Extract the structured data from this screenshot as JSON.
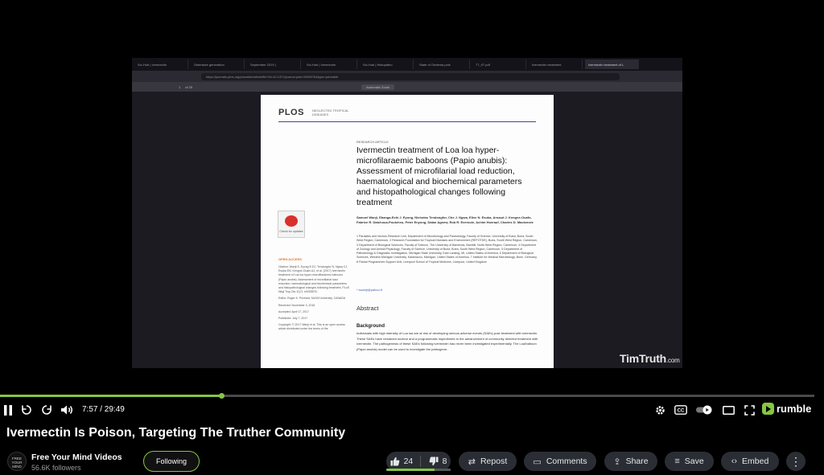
{
  "browser": {
    "tabs": [
      "Sci-Hub | Ivermectin",
      "Ostensive generation",
      "September 2019 |",
      "Sci-Hub | Ivermectin",
      "Sci-Hub | Histopatho",
      "State of Oedema pois",
      "77_97.pdf",
      "Ivermectin treatment",
      "Ivermectin treatment of L"
    ],
    "url": "https://journals.plos.org/plosntds/article/file?id=10.1371/journal.pntd.0005576&type=printable",
    "page_indicator": "1",
    "page_total": "of 25",
    "zoom": "Automatic Zoom"
  },
  "paper": {
    "journal": "PLOS",
    "journal_sub": "NEGLECTED TROPICAL DISEASES",
    "kicker": "RESEARCH ARTICLE",
    "title": "Ivermectin treatment of Loa loa hyper-microfilaraemic baboons (Papio anubis): Assessment of microfilarial load reduction, haematological and biochemical parameters and histopathological changes following treatment",
    "authors": "Samuel Wanji, Ebanga-Echi J. Eyong, Nicholas Tendongfor, Che J. Ngwa, Elive N. Esuka, Arnaud J. Kengne-Ouafo, Fabrice R. Datchoua-Poutcheu, Peter Enyong, Dalan Agnew, Rob R. Eversole, Achim Hoerauf, Charles D. Mackenzie",
    "affiliations": "1 Parasites and Vectors Research Unit, Department of Microbiology and Parasitology, Faculty of Science, University of Buea, Buea, South West Region, Cameroon, 2 Research Foundation for Tropical Diseases and Environment (REFOTDE), Buea, South West Region, Cameroon, 3 Department of Biological Sciences, Faculty of Science, The University of Bamenda, Bambili, North West Region, Cameroon, 4 Department of Zoology and Animal Physiology, Faculty of Science, University of Buea, Buea, South West Region, Cameroon, 5 Department of Pathobiology & Diagnostic Investigation, Michigan State University, East Lansing, MI, United States of America, 6 Department of Biological Sciences, Western Michigan University, Kalamazoo, Michigan, United States of America, 7 Institute for Medical Microbiology, Bonn, Germany, 8 Filarial Programmes Support Unit, Liverpool School of Tropical Medicine, Liverpool, United Kingdom",
    "email": "* swanji@yahoo.fr",
    "abstract": "Abstract",
    "background_heading": "Background",
    "background_text": "Individuals with high intensity of Loa loa are at risk of developing serious adverse events (SAEs) post treatment with ivermectin. These SAEs have remained unclear and a programmatic impediment to the advancement of community directed treatment with ivermectin. The pathogenesis of these SAEs following ivermectin has never been investigated experimentally. The Loa/baboon (Papio anubis) model can be used to investigate the pathogene-",
    "check_updates": "Check for updates",
    "open_access": "OPEN ACCESS",
    "citation": "Citation: Wanji S, Eyong E-EJ, Tendongfor N, Ngwa CJ, Esuka EN, Kengne-Ouafo AJ, et al. (2017) Ivermectin treatment of Loa loa hyper-microfilaraemic baboons (Papio anubis): Assessment of microfilarial load reduction, haematological and biochemical parameters and histopathological changes following treatment. PLoS Negl Trop Dis 11(7): e0005576.",
    "editor": "Editor: Roger K. Prichard, McGill University, CANADA",
    "received": "Received: November 3, 2016",
    "accepted": "Accepted: April 17, 2017",
    "published": "Published: July 7, 2017",
    "copyright": "Copyright: © 2017 Wanji et al. This is an open access article distributed under the terms of the"
  },
  "watermark": "TimTruth",
  "watermark_suffix": ".com",
  "player": {
    "progress": 0.272,
    "current_time": "7:57",
    "duration": "29:49",
    "time_display": "7:57 / 29:49",
    "brand": "rumble"
  },
  "video": {
    "title": "Ivermectin Is Poison, Targeting The Truther Community"
  },
  "channel": {
    "avatar_text": "FREE YOUR MIND",
    "name": "Free Your Mind Videos",
    "followers": "56.6K followers",
    "follow_label": "Following"
  },
  "actions": {
    "likes": "24",
    "dislikes": "8",
    "like_ratio": 0.75,
    "repost": "Repost",
    "comments": "Comments",
    "share": "Share",
    "save": "Save",
    "embed": "Embed"
  },
  "colors": {
    "accent": "#85c742",
    "pill_bg": "#2a2e34"
  }
}
